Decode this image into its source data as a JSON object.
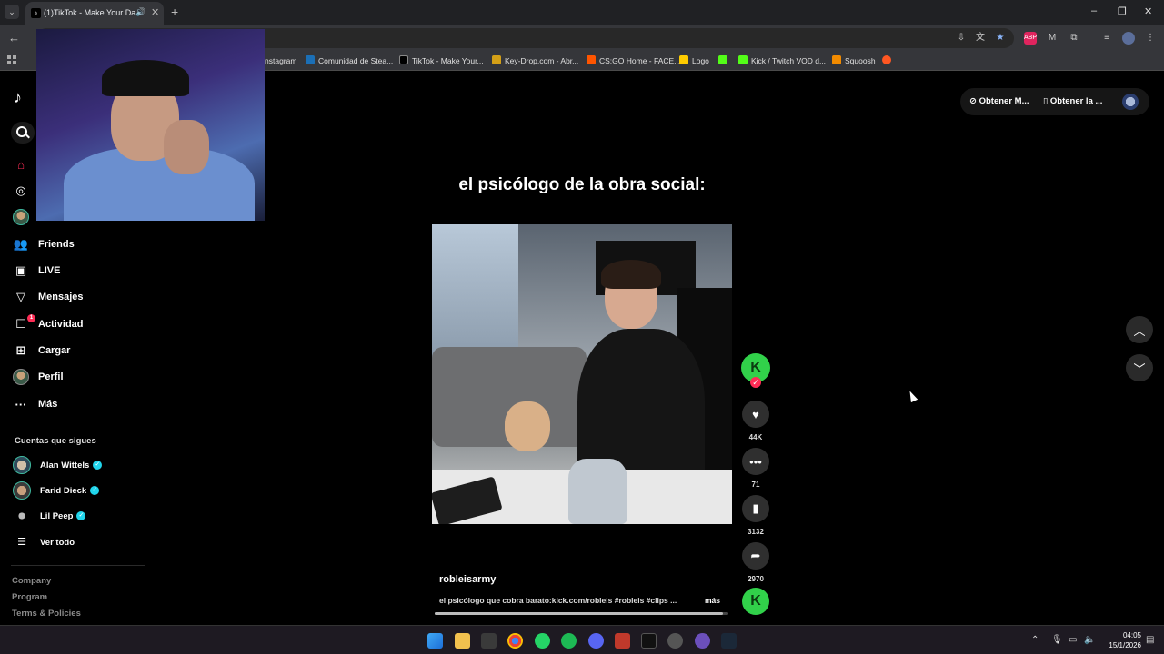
{
  "browser": {
    "tab_title": "(1)TikTok - Make Your Day",
    "tab_icon": "tiktok-icon",
    "new_tab_label": "+",
    "window_controls": [
      "–",
      "❐",
      "✕"
    ],
    "bookmarks": [
      {
        "label": "nstagram",
        "color": "#c13584"
      },
      {
        "label": "Comunidad de Stea...",
        "color": "#1b6fb6"
      },
      {
        "label": "TikTok - Make Your...",
        "color": "#000000"
      },
      {
        "label": "Key-Drop.com - Abr...",
        "color": "#d4a017"
      },
      {
        "label": "CS:GO Home - FACE...",
        "color": "#ff5500"
      },
      {
        "label": "Logo",
        "color": "#ffcc00"
      },
      {
        "label": "",
        "color": "#53fc18"
      },
      {
        "label": "Kick / Twitch VOD d...",
        "color": "#53fc18"
      },
      {
        "label": "Squoosh",
        "color": "#f28b00"
      },
      {
        "label": "",
        "color": "#ff5722"
      }
    ]
  },
  "sidebar": {
    "items": [
      {
        "label": "Friends",
        "icon": "friends-icon"
      },
      {
        "label": "LIVE",
        "icon": "live-icon"
      },
      {
        "label": "Mensajes",
        "icon": "messages-icon"
      },
      {
        "label": "Actividad",
        "icon": "activity-icon",
        "badge": "1"
      },
      {
        "label": "Cargar",
        "icon": "upload-icon"
      },
      {
        "label": "Perfil",
        "icon": "profile-icon"
      },
      {
        "label": "Más",
        "icon": "more-icon"
      }
    ],
    "following_title": "Cuentas que sigues",
    "following": [
      {
        "name": "Alan Wittels"
      },
      {
        "name": "Farid Dieck"
      },
      {
        "name": "Lil Peep"
      }
    ],
    "see_all": "Ver todo",
    "footer": [
      "Company",
      "Program",
      "Terms & Policies"
    ]
  },
  "video": {
    "caption": "el psicólogo de la obra social:",
    "author": "robleisarmy",
    "description": "el psicólogo que cobra barato:kick.com/robleis #robleis #clips ...",
    "more_label": "más",
    "progress": 0.98,
    "likes": "44K",
    "comments": "71",
    "saves": "3132",
    "shares": "2970"
  },
  "top_actions": {
    "get_coins": "Obtener M...",
    "get_app": "Obtener la ..."
  },
  "taskbar": {
    "time": "04:05",
    "date": "15/1/2026"
  },
  "colors": {
    "accent": "#fe2c55",
    "verified": "#20d5ec",
    "kick_green": "#31d14a"
  }
}
